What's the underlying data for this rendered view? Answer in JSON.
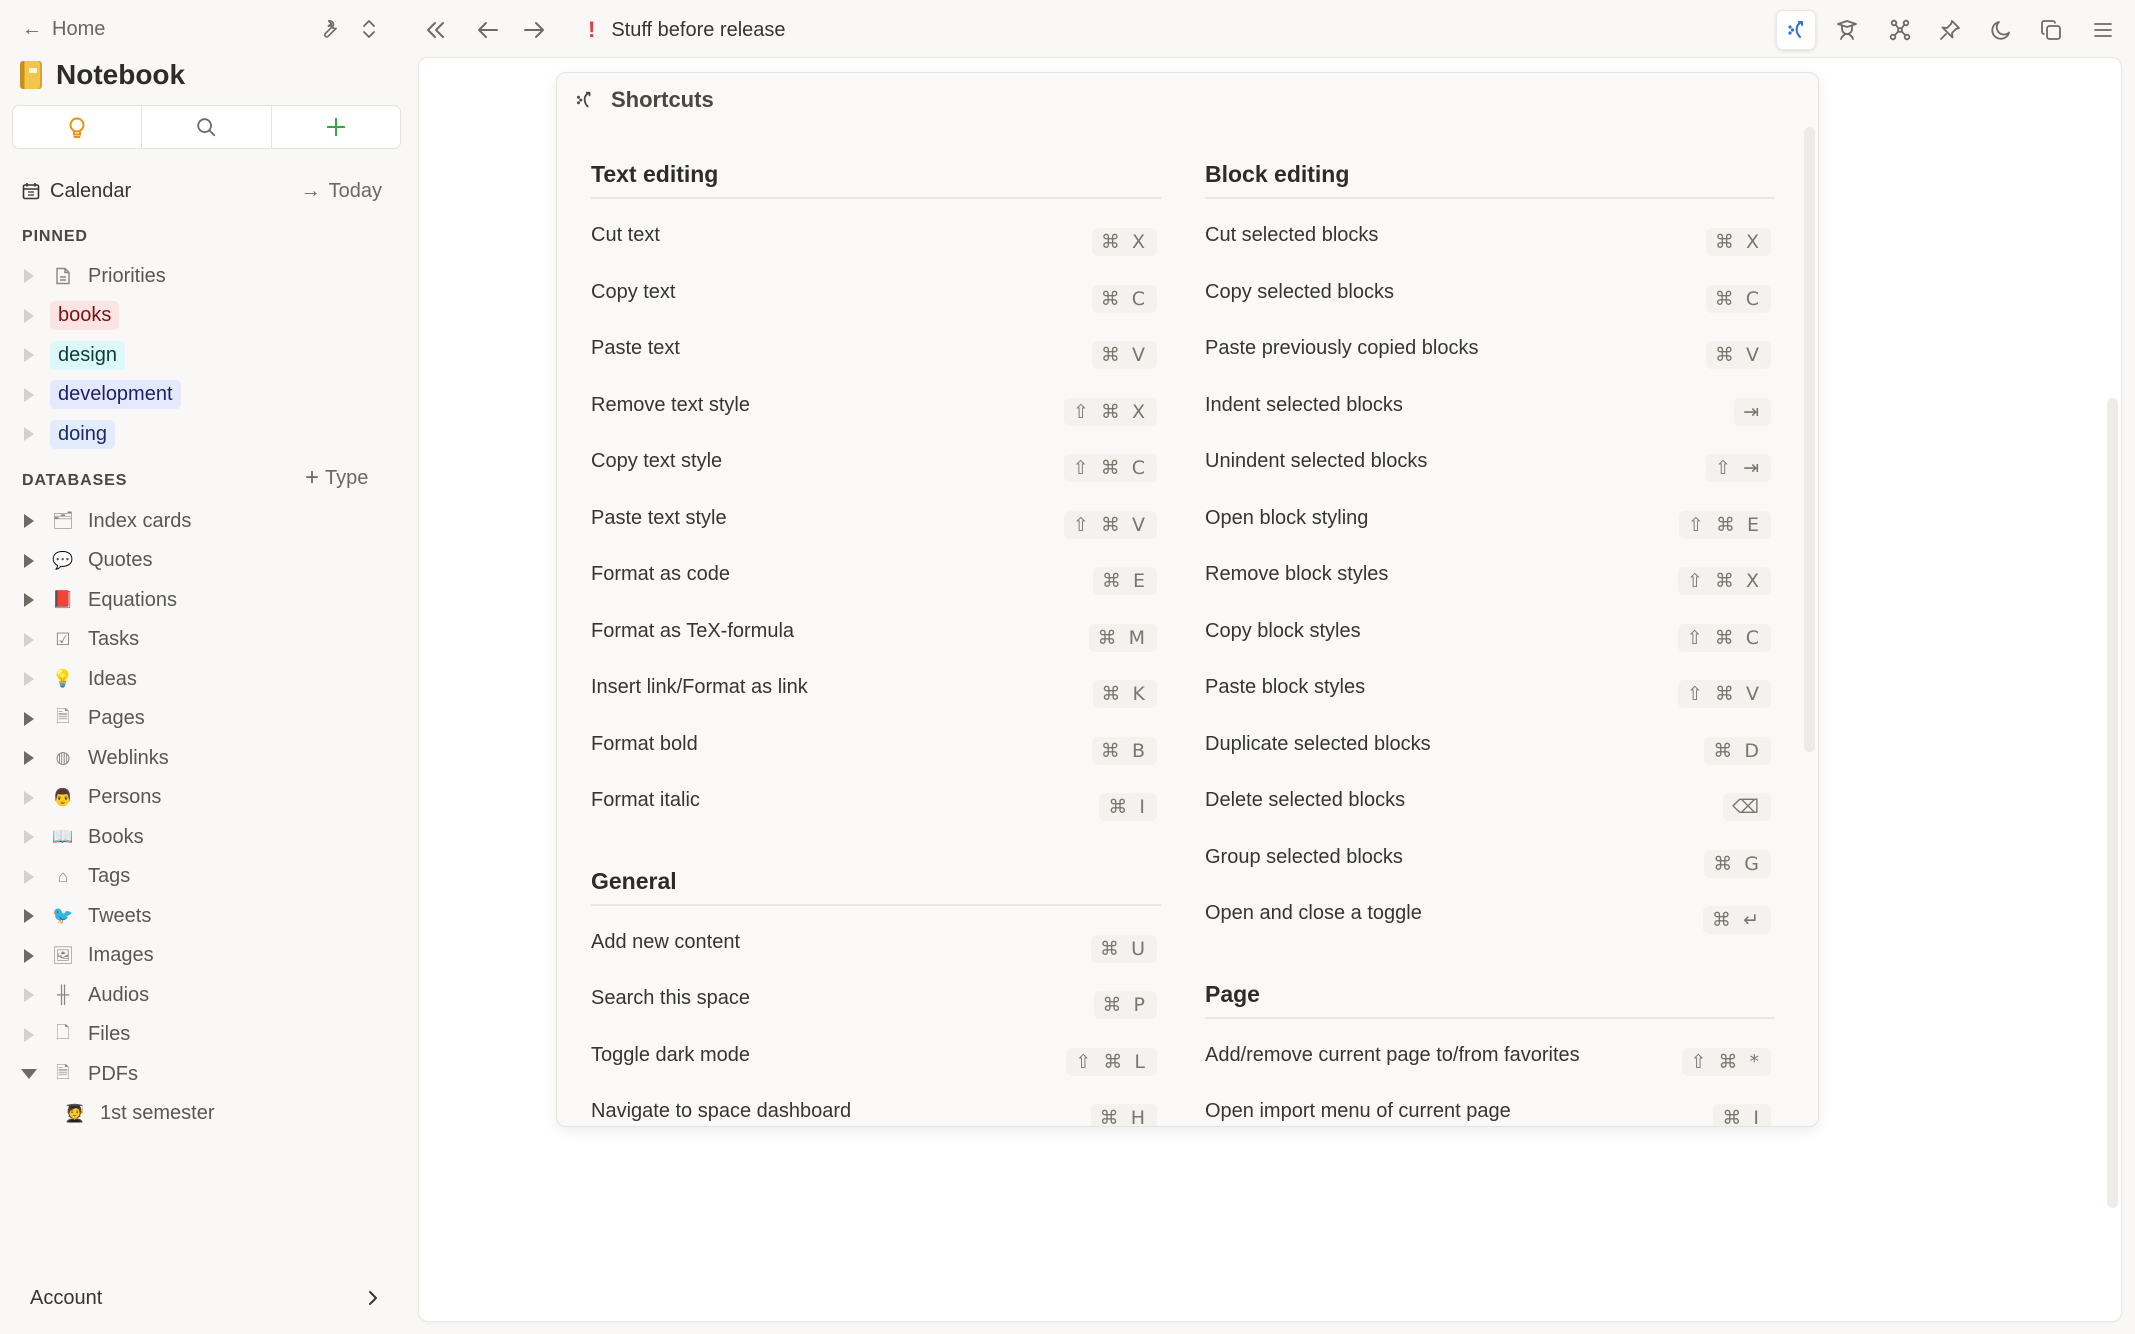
{
  "sidebar": {
    "home_label": "Home",
    "workspace_title": "Notebook",
    "action_tabs": [
      "ideas-bulb",
      "search",
      "add"
    ],
    "calendar_label": "Calendar",
    "today_label": "Today",
    "pinned_label": "PINNED",
    "pinned": [
      {
        "label": "Priorities",
        "kind": "page",
        "has_children": false
      },
      {
        "label": "books",
        "kind": "tag",
        "bg": "#fde4e4",
        "fg": "#7a1212",
        "has_children": false
      },
      {
        "label": "design",
        "kind": "tag",
        "bg": "#dcf8f8",
        "fg": "#0d3b3b",
        "has_children": false
      },
      {
        "label": "development",
        "kind": "tag",
        "bg": "#e5e9fd",
        "fg": "#1b1f6b",
        "has_children": false
      },
      {
        "label": "doing",
        "kind": "tag",
        "bg": "#e3ecfd",
        "fg": "#1a2a6e",
        "has_children": false
      }
    ],
    "databases_label": "DATABASES",
    "add_type_label": "Type",
    "databases": [
      {
        "label": "Index cards",
        "icon": "card-index-icon",
        "glyph": "🗂",
        "has_children": true
      },
      {
        "label": "Quotes",
        "icon": "speech-bubble-icon",
        "glyph": "💬",
        "has_children": true
      },
      {
        "label": "Equations",
        "icon": "red-book-icon",
        "glyph": "📕",
        "has_children": true
      },
      {
        "label": "Tasks",
        "icon": "checkbox-icon",
        "glyph": "☑",
        "has_children": false
      },
      {
        "label": "Ideas",
        "icon": "light-bulb-icon",
        "glyph": "💡",
        "has_children": false
      },
      {
        "label": "Pages",
        "icon": "page-icon",
        "glyph": "🗎",
        "has_children": true
      },
      {
        "label": "Weblinks",
        "icon": "globe-icon",
        "glyph": "◍",
        "has_children": true
      },
      {
        "label": "Persons",
        "icon": "person-icon",
        "glyph": "👨",
        "has_children": false
      },
      {
        "label": "Books",
        "icon": "open-book-icon",
        "glyph": "📖",
        "has_children": false
      },
      {
        "label": "Tags",
        "icon": "tag-icon",
        "glyph": "⌂",
        "has_children": false
      },
      {
        "label": "Tweets",
        "icon": "bird-icon",
        "glyph": "🐦",
        "has_children": true
      },
      {
        "label": "Images",
        "icon": "image-icon",
        "glyph": "🖼",
        "has_children": true
      },
      {
        "label": "Audios",
        "icon": "waveform-icon",
        "glyph": "╫",
        "has_children": false
      },
      {
        "label": "Files",
        "icon": "file-icon",
        "glyph": "🗋",
        "has_children": false
      },
      {
        "label": "PDFs",
        "icon": "pdf-icon",
        "glyph": "🗎",
        "has_children": true,
        "expanded": true
      }
    ],
    "pdf_children": [
      {
        "label": "1st semester",
        "icon": "student-icon",
        "glyph": "🧑‍🎓"
      }
    ],
    "account_label": "Account"
  },
  "topbar": {
    "breadcrumb_marker": "!",
    "breadcrumb_title": "Stuff before release",
    "marker_color": "#e03e3e",
    "active_tool_color": "#2f6fd6"
  },
  "shortcuts": {
    "title": "Shortcuts",
    "left_sections": [
      {
        "title": "Text editing",
        "items": [
          {
            "label": "Cut text",
            "keys": "⌘ X"
          },
          {
            "label": "Copy text",
            "keys": "⌘ C"
          },
          {
            "label": "Paste text",
            "keys": "⌘ V"
          },
          {
            "label": "Remove text style",
            "keys": "⇧ ⌘ X"
          },
          {
            "label": "Copy text style",
            "keys": "⇧ ⌘ C"
          },
          {
            "label": "Paste text style",
            "keys": "⇧ ⌘ V"
          },
          {
            "label": "Format as code",
            "keys": "⌘ E"
          },
          {
            "label": "Format as TeX-formula",
            "keys": "⌘ M"
          },
          {
            "label": "Insert link/Format as link",
            "keys": "⌘ K"
          },
          {
            "label": "Format bold",
            "keys": "⌘ B"
          },
          {
            "label": "Format italic",
            "keys": "⌘ I"
          }
        ]
      },
      {
        "title": "General",
        "items": [
          {
            "label": "Add new content",
            "keys": "⌘ U"
          },
          {
            "label": "Search this space",
            "keys": "⌘ P"
          },
          {
            "label": "Toggle dark mode",
            "keys": "⇧ ⌘ L"
          },
          {
            "label": "Navigate to space dashboard",
            "keys": "⌘ H"
          }
        ]
      }
    ],
    "right_sections": [
      {
        "title": "Block editing",
        "items": [
          {
            "label": "Cut selected blocks",
            "keys": "⌘ X"
          },
          {
            "label": "Copy selected blocks",
            "keys": "⌘ C"
          },
          {
            "label": "Paste previously copied blocks",
            "keys": "⌘ V"
          },
          {
            "label": "Indent selected blocks",
            "keys": "⇥"
          },
          {
            "label": "Unindent selected blocks",
            "keys": "⇧ ⇥"
          },
          {
            "label": "Open block styling",
            "keys": "⇧ ⌘ E"
          },
          {
            "label": "Remove block styles",
            "keys": "⇧ ⌘ X"
          },
          {
            "label": "Copy block styles",
            "keys": "⇧ ⌘ C"
          },
          {
            "label": "Paste block styles",
            "keys": "⇧ ⌘ V"
          },
          {
            "label": "Duplicate selected blocks",
            "keys": "⌘ D"
          },
          {
            "label": "Delete selected blocks",
            "keys": "⌫"
          },
          {
            "label": "Group selected blocks",
            "keys": "⌘ G"
          },
          {
            "label": "Open and close a toggle",
            "keys": "⌘ ↵"
          }
        ]
      },
      {
        "title": "Page",
        "items": [
          {
            "label": "Add/remove current page to/from favorites",
            "keys": "⇧ ⌘ *"
          },
          {
            "label": "Open import menu of current page",
            "keys": "⌘ I"
          }
        ]
      }
    ]
  }
}
